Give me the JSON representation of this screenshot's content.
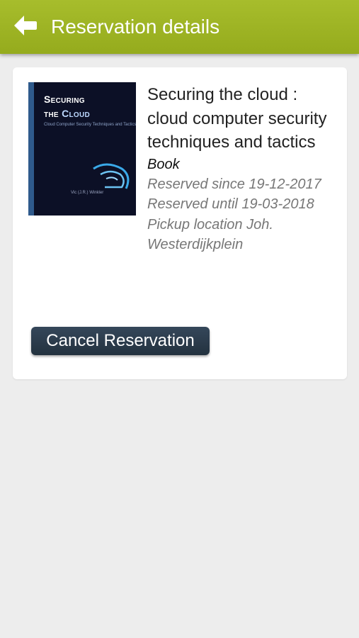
{
  "header": {
    "title": "Reservation details",
    "back_icon": "arrow-left-icon",
    "bar_color": "#9fb526"
  },
  "reservation": {
    "cover": {
      "title_line1": "Securing",
      "title_line2_a": "the ",
      "title_line2_b": "Cloud",
      "subtitle": "Cloud Computer Security Techniques and Tactics",
      "author": "Vic (J.R.) Winkler"
    },
    "title": "Securing the cloud : cloud computer security techniques and tactics",
    "type": "Book",
    "reserved_since": "Reserved since 19-12-2017",
    "reserved_until": "Reserved until 19-03-2018",
    "pickup": "Pickup location Joh. Westerdijkplein",
    "cancel_label": "Cancel Reservation",
    "button_color": "#2b3b4b"
  }
}
